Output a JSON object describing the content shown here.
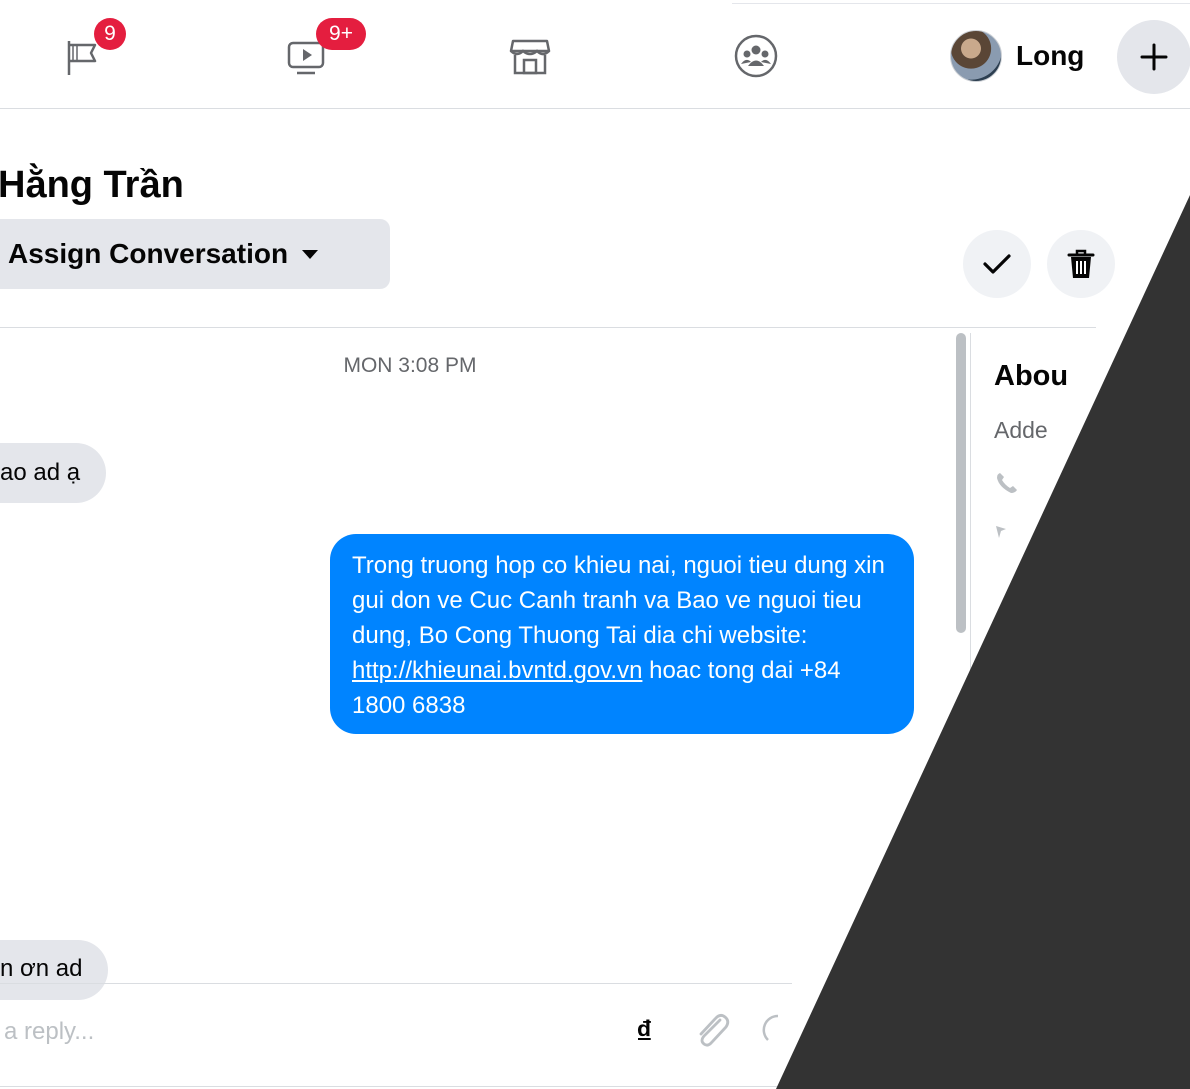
{
  "topbar": {
    "nav": [
      {
        "name": "pages",
        "icon": "flag-icon",
        "badge": "9"
      },
      {
        "name": "watch",
        "icon": "video-icon",
        "badge": "9+"
      },
      {
        "name": "marketplace",
        "icon": "store-icon",
        "badge": ""
      },
      {
        "name": "groups",
        "icon": "groups-icon",
        "badge": ""
      }
    ],
    "profile_name": "Long",
    "badge_color": "#e41e3f"
  },
  "conversation": {
    "contact_name": "Hằng Trần",
    "assign_label": "Assign Conversation",
    "timestamp": "MON 3:08 PM",
    "incoming_1": "ao ad ạ",
    "incoming_2": "n ơn ad",
    "outgoing": {
      "text_before_link": "Trong truong hop co khieu nai, nguoi tieu dung xin gui don ve Cuc Canh tranh va Bao ve nguoi tieu dung, Bo Cong Thuong Tai dia chi website: ",
      "link": "http://khieunai.bvntd.gov.vn",
      "text_after_link": " hoac tong dai +84 1800 6838",
      "color": "#0084ff"
    }
  },
  "about": {
    "title": "Abou",
    "added": "Adde"
  },
  "composer": {
    "placeholder": "a reply...",
    "currency_symbol": "₫"
  },
  "overlay_color": "#333333"
}
